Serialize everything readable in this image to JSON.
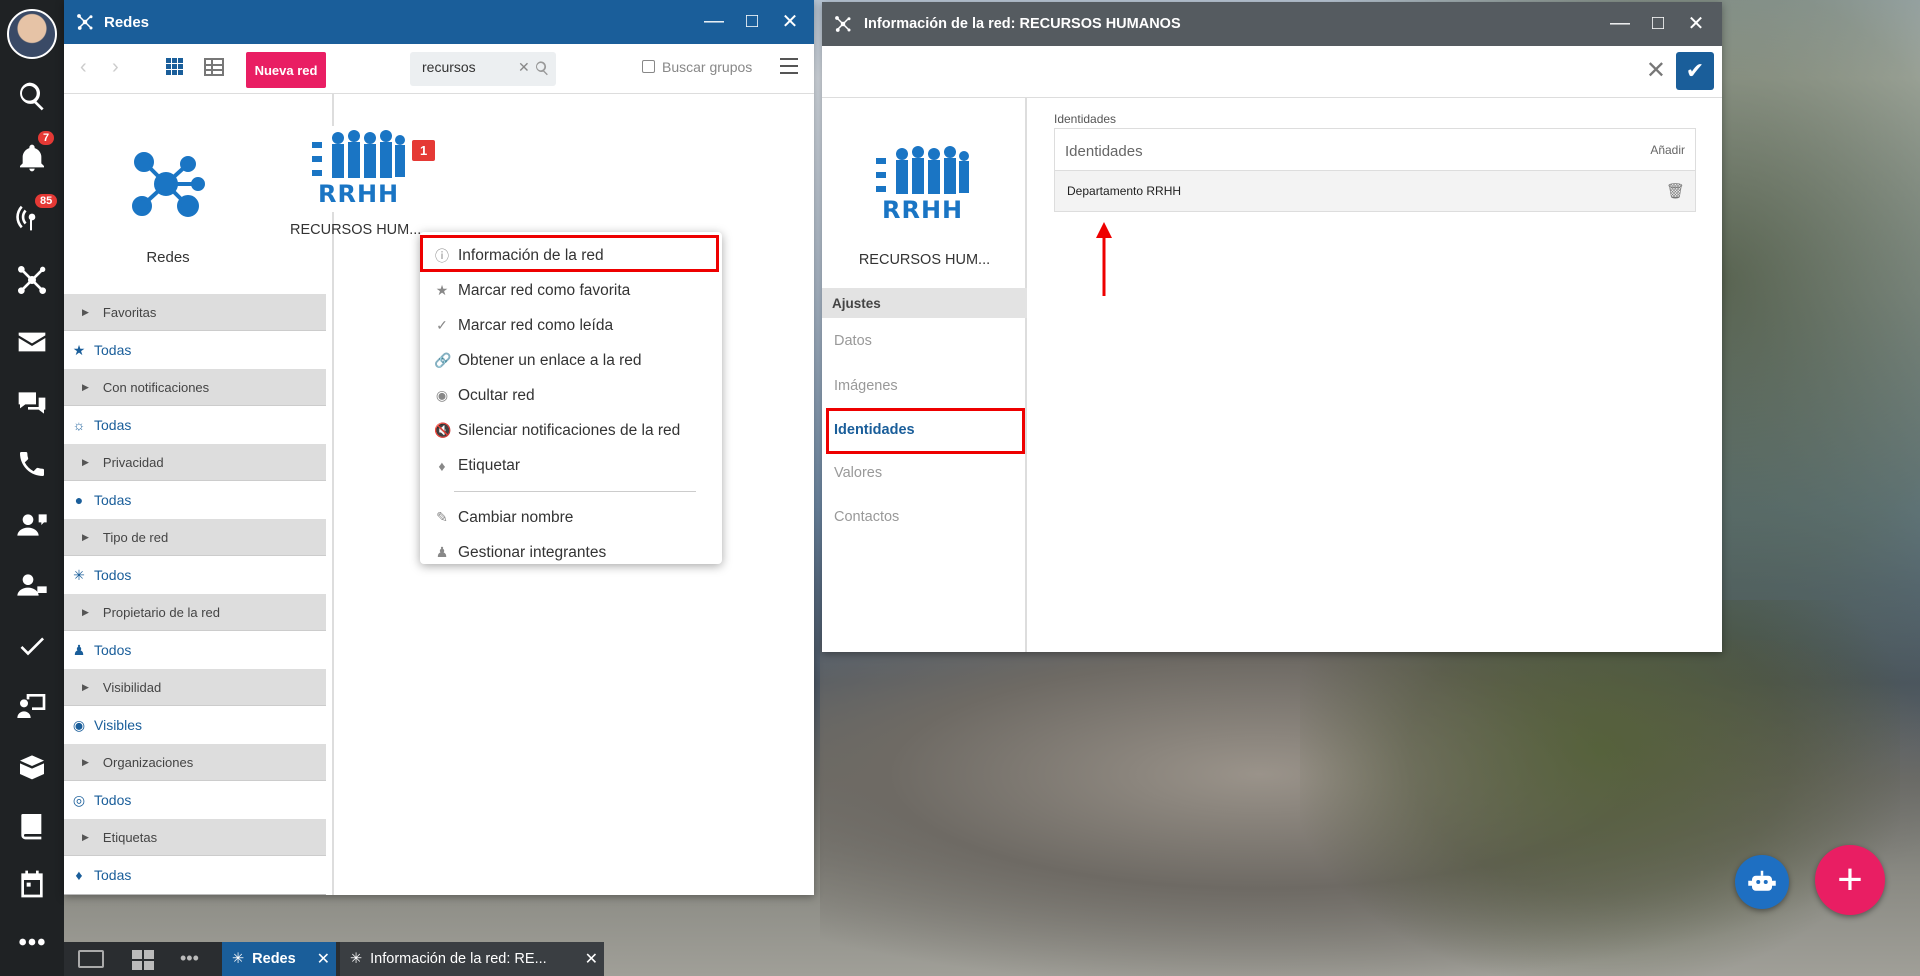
{
  "left_sidebar": {
    "notification_badge": "7",
    "radio_badge": "85",
    "icons": [
      "search-icon",
      "bell-icon",
      "broadcast-icon",
      "network-icon",
      "mail-icon",
      "chat-icon",
      "phone-icon",
      "support-icon",
      "helpdesk-icon",
      "check-icon",
      "presentation-icon",
      "boxes-icon",
      "book-icon",
      "calendar-icon",
      "more-icon"
    ]
  },
  "redes_window": {
    "title": "Redes",
    "new_button": "Nueva red",
    "search_value": "recursos",
    "search_groups_label": "Buscar grupos",
    "side_title": "Redes",
    "filters": [
      {
        "category": "Favoritas",
        "value": "Todas"
      },
      {
        "category": "Con notificaciones",
        "value": "Todas"
      },
      {
        "category": "Privacidad",
        "value": "Todas"
      },
      {
        "category": "Tipo de red",
        "value": "Todos"
      },
      {
        "category": "Propietario de la red",
        "value": "Todos"
      },
      {
        "category": "Visibilidad",
        "value": "Visibles"
      },
      {
        "category": "Organizaciones",
        "value": "Todos"
      },
      {
        "category": "Etiquetas",
        "value": "Todas"
      }
    ],
    "network": {
      "name": "RECURSOS HUM...",
      "badge": "1",
      "logo_text": "RRHH"
    }
  },
  "context_menu": {
    "items": [
      "Información de la red",
      "Marcar red como favorita",
      "Marcar red como leída",
      "Obtener un enlace a la red",
      "Ocultar red",
      "Silenciar notificaciones de la red",
      "Etiquetar"
    ],
    "items2": [
      "Cambiar nombre",
      "Gestionar integrantes"
    ]
  },
  "info_window": {
    "title": "Información de la red: RECURSOS HUMANOS",
    "network_name": "RECURSOS HUM...",
    "logo_text": "RRHH",
    "settings_header": "Ajustes",
    "settings": [
      "Datos",
      "Imágenes",
      "Identidades",
      "Valores",
      "Contactos"
    ],
    "identities_label": "Identidades",
    "identities_placeholder": "Identidades",
    "add_label": "Añadir",
    "identity_row": "Departamento RRHH"
  },
  "taskbar": {
    "task1": "Redes",
    "task2": "Información de la red: RE..."
  },
  "colors": {
    "brand_blue": "#1a5e9a",
    "accent_pink": "#e91e63",
    "highlight_red": "#e00000"
  }
}
